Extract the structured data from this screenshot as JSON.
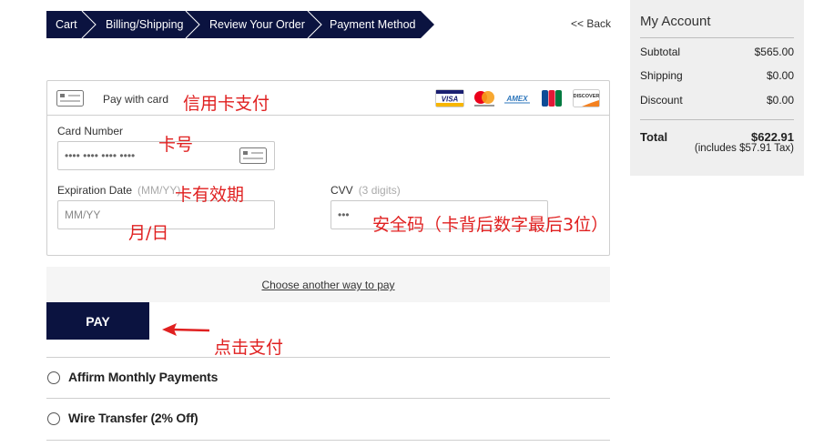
{
  "breadcrumb": {
    "steps": [
      "Cart",
      "Billing/Shipping",
      "Review Your Order",
      "Payment Method"
    ],
    "back_label": "<< Back"
  },
  "card_form": {
    "header_label": "Pay with card",
    "brands": [
      "VISA",
      "Mastercard",
      "AMEX",
      "JCB",
      "DISCOVER"
    ],
    "card_number_label": "Card Number",
    "card_number_value": "•••• •••• •••• ••••",
    "expiration_label": "Expiration Date",
    "expiration_hint": "(MM/YY)",
    "expiration_placeholder": "MM/YY",
    "cvv_label": "CVV",
    "cvv_hint": "(3 digits)",
    "cvv_value": "•••"
  },
  "annotations": {
    "pay_with_card": "信用卡支付",
    "card_number": "卡号",
    "expiration": "卡有效期",
    "month_day": "月/日",
    "cvv": "安全码（卡背后数字最后3位）",
    "click_pay": "点击支付"
  },
  "another_way_label": "Choose another way to pay",
  "pay_button_label": "PAY",
  "payment_options": [
    "Affirm Monthly Payments",
    "Wire Transfer (2% Off)"
  ],
  "account": {
    "title": "My Account",
    "rows": [
      {
        "label": "Subtotal",
        "value": "$565.00"
      },
      {
        "label": "Shipping",
        "value": "$0.00"
      },
      {
        "label": "Discount",
        "value": "$0.00"
      }
    ],
    "total_label": "Total",
    "total_value": "$622.91",
    "total_note": "(includes $57.91 Tax)"
  },
  "colors": {
    "navy": "#0b1340",
    "annotation_red": "#e02020",
    "sidebar_bg": "#efefef"
  }
}
